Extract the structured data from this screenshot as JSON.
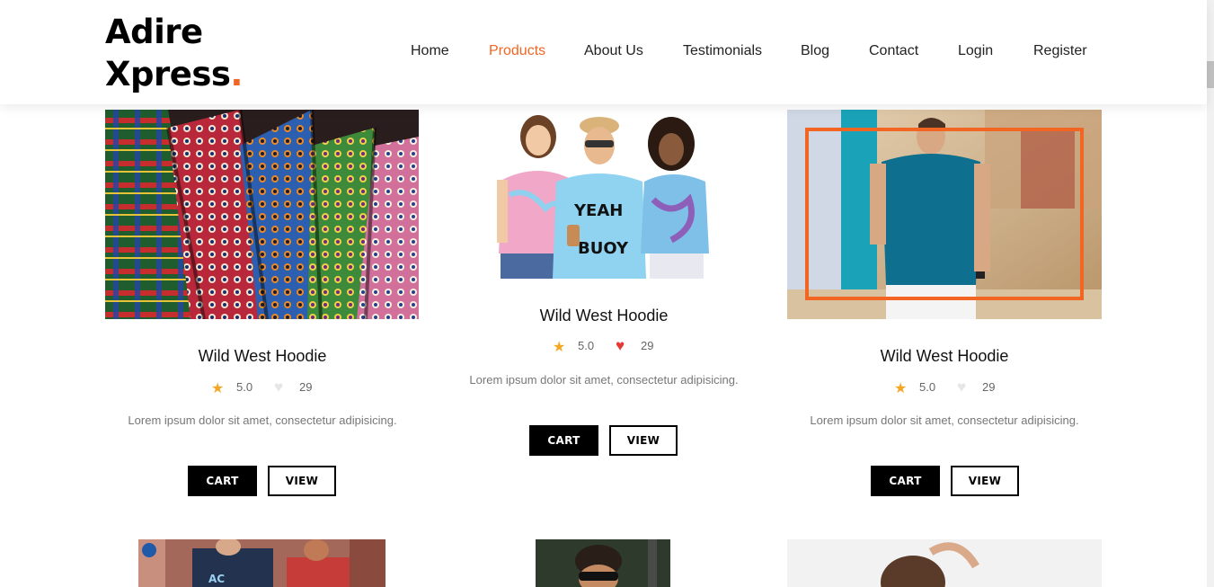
{
  "brand": {
    "line1": "Adire",
    "line2": "Xpress",
    "dot": ".",
    "accent_color": "#f26522"
  },
  "nav": {
    "items": [
      {
        "label": "Home",
        "active": false
      },
      {
        "label": "Products",
        "active": true
      },
      {
        "label": "About Us",
        "active": false
      },
      {
        "label": "Testimonials",
        "active": false
      },
      {
        "label": "Blog",
        "active": false
      },
      {
        "label": "Contact",
        "active": false
      },
      {
        "label": "Login",
        "active": false
      },
      {
        "label": "Register",
        "active": false
      }
    ]
  },
  "products": [
    {
      "image": "neckties-photo",
      "title": "Wild West Hoodie",
      "rating": "5.0",
      "likes": "29",
      "liked": false,
      "description": "Lorem ipsum dolor sit amet, consectetur adipisicing.",
      "cart_label": "CART",
      "view_label": "VIEW"
    },
    {
      "image": "tie-dye-group-photo",
      "title": "Wild West Hoodie",
      "rating": "5.0",
      "likes": "29",
      "liked": true,
      "description": "Lorem ipsum dolor sit amet, consectetur adipisicing.",
      "cart_label": "CART",
      "view_label": "VIEW"
    },
    {
      "image": "teal-tshirt-model-photo",
      "title": "Wild West Hoodie",
      "rating": "5.0",
      "likes": "29",
      "liked": false,
      "description": "Lorem ipsum dolor sit amet, consectetur adipisicing.",
      "cart_label": "CART",
      "view_label": "VIEW"
    }
  ],
  "icons": {
    "star": "star-icon",
    "heart": "heart-icon"
  },
  "colors": {
    "star": "#f5a623",
    "heart_liked": "#e53935",
    "heart_unliked": "#e6e6e6",
    "button_dark": "#000000"
  }
}
